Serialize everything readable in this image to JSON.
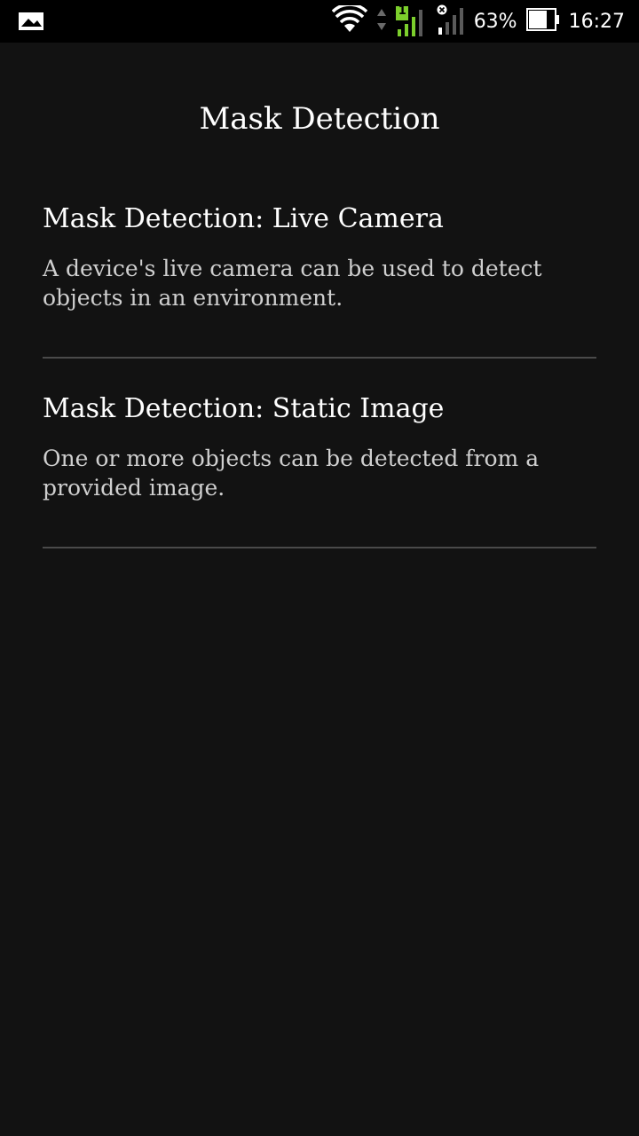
{
  "status_bar": {
    "battery_percent": "63%",
    "time": "16:27",
    "sim_badge": "1",
    "icons": [
      "gallery-notification-icon",
      "wifi-icon",
      "data-arrows-icon",
      "signal-sim1-icon",
      "signal-sim2-no-service-icon",
      "battery-icon"
    ]
  },
  "header": {
    "title": "Mask Detection"
  },
  "options": [
    {
      "title": "Mask Detection: Live Camera",
      "description": "A device's live camera can be used to detect objects in an environment."
    },
    {
      "title": "Mask Detection: Static Image",
      "description": "One or more objects can be detected from a provided image."
    }
  ],
  "colors": {
    "background": "#121212",
    "status_bar": "#000000",
    "signal_active": "#7ccf2c",
    "divider": "#4a4a4a"
  }
}
